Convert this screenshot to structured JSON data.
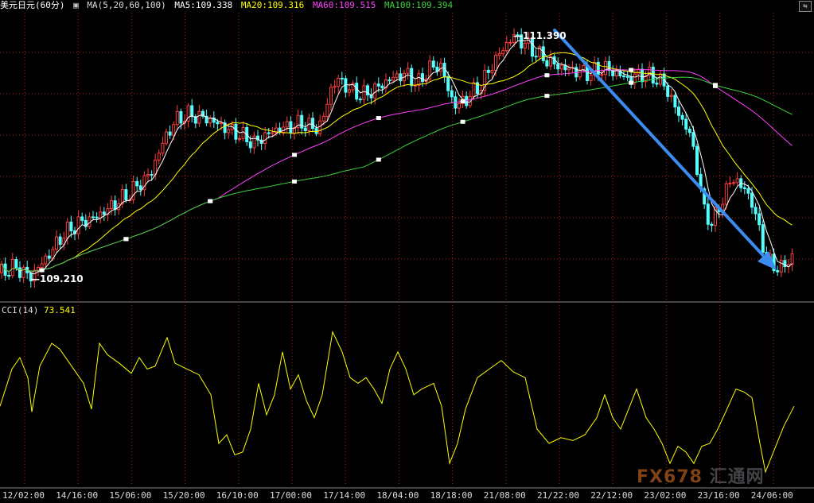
{
  "header": {
    "symbol": "美元日元(60分)",
    "ma_params": "MA(5,20,60,100)",
    "ma5": "MA5:109.338",
    "ma20": "MA20:109.316",
    "ma60": "MA60:109.515",
    "ma100": "MA100:109.394"
  },
  "cci_header": {
    "label": "CCI(14)",
    "value": "73.541"
  },
  "annotations": {
    "high": "111.390",
    "low": "109.210"
  },
  "watermark": {
    "fx": "FX678",
    "cn": "汇通网"
  },
  "colors": {
    "up": "#ff3c3c",
    "down": "#54ffff",
    "ma5": "#ffffff",
    "ma20": "#ffff00",
    "ma60": "#ff40ff",
    "ma100": "#3cd23c",
    "cci": "#ffff00",
    "arrow": "#3c8cf0",
    "grid": "#b41e1e"
  },
  "chart_data": [
    {
      "type": "candlestick",
      "title": "美元日元(60分)",
      "x_ticks": [
        "12/02:00",
        "14/16:00",
        "15/06:00",
        "15/20:00",
        "16/10:00",
        "17/00:00",
        "17/14:00",
        "18/04:00",
        "18/18:00",
        "21/08:00",
        "21/22:00",
        "22/12:00",
        "23/02:00",
        "23/16:00",
        "24/06:00"
      ],
      "ylim": [
        109.0,
        111.6
      ],
      "grid": true,
      "close_path": [
        [
          0,
          109.25
        ],
        [
          20,
          109.3
        ],
        [
          38,
          109.21
        ],
        [
          60,
          109.4
        ],
        [
          80,
          109.6
        ],
        [
          100,
          109.7
        ],
        [
          120,
          109.75
        ],
        [
          140,
          109.85
        ],
        [
          160,
          109.95
        ],
        [
          175,
          110.05
        ],
        [
          190,
          110.15
        ],
        [
          200,
          110.35
        ],
        [
          210,
          110.5
        ],
        [
          220,
          110.62
        ],
        [
          235,
          110.68
        ],
        [
          250,
          110.66
        ],
        [
          265,
          110.63
        ],
        [
          285,
          110.55
        ],
        [
          300,
          110.5
        ],
        [
          320,
          110.42
        ],
        [
          335,
          110.5
        ],
        [
          350,
          110.55
        ],
        [
          365,
          110.57
        ],
        [
          380,
          110.6
        ],
        [
          395,
          110.55
        ],
        [
          405,
          110.6
        ],
        [
          415,
          110.9
        ],
        [
          425,
          111.0
        ],
        [
          440,
          110.9
        ],
        [
          455,
          110.85
        ],
        [
          470,
          110.9
        ],
        [
          490,
          111.0
        ],
        [
          510,
          111.05
        ],
        [
          525,
          110.95
        ],
        [
          540,
          111.1
        ],
        [
          555,
          111.12
        ],
        [
          565,
          110.85
        ],
        [
          575,
          110.75
        ],
        [
          590,
          110.85
        ],
        [
          605,
          110.95
        ],
        [
          620,
          111.15
        ],
        [
          635,
          111.3
        ],
        [
          645,
          111.39
        ],
        [
          660,
          111.32
        ],
        [
          680,
          111.2
        ],
        [
          700,
          111.12
        ],
        [
          720,
          111.08
        ],
        [
          740,
          111.05
        ],
        [
          760,
          111.1
        ],
        [
          775,
          111.05
        ],
        [
          790,
          111.0
        ],
        [
          805,
          111.05
        ],
        [
          820,
          111.02
        ],
        [
          835,
          110.95
        ],
        [
          845,
          110.8
        ],
        [
          855,
          110.65
        ],
        [
          865,
          110.55
        ],
        [
          875,
          110.25
        ],
        [
          885,
          109.8
        ],
        [
          895,
          109.7
        ],
        [
          905,
          109.85
        ],
        [
          915,
          110.05
        ],
        [
          925,
          110.1
        ],
        [
          935,
          110.0
        ],
        [
          945,
          109.9
        ],
        [
          955,
          109.6
        ],
        [
          965,
          109.35
        ],
        [
          975,
          109.3
        ],
        [
          985,
          109.3
        ],
        [
          998,
          109.42
        ]
      ],
      "ma_lines": [
        {
          "name": "MA5",
          "value": "109.338"
        },
        {
          "name": "MA20",
          "value": "109.316"
        },
        {
          "name": "MA60",
          "value": "109.515"
        },
        {
          "name": "MA100",
          "value": "109.394"
        }
      ],
      "annotations": [
        {
          "text": "111.390",
          "x": 645,
          "y": 111.39
        },
        {
          "text": "109.210",
          "x": 38,
          "y": 109.21
        }
      ]
    },
    {
      "type": "line",
      "title": "CCI(14)",
      "value": "73.541",
      "ylim": [
        -300,
        300
      ],
      "series": [
        {
          "points": [
            [
              0,
              -20
            ],
            [
              15,
              110
            ],
            [
              25,
              150
            ],
            [
              35,
              80
            ],
            [
              40,
              -40
            ],
            [
              50,
              120
            ],
            [
              65,
              200
            ],
            [
              75,
              180
            ],
            [
              90,
              120
            ],
            [
              105,
              60
            ],
            [
              115,
              -30
            ],
            [
              125,
              200
            ],
            [
              135,
              160
            ],
            [
              150,
              130
            ],
            [
              165,
              95
            ],
            [
              175,
              150
            ],
            [
              185,
              110
            ],
            [
              195,
              120
            ],
            [
              210,
              220
            ],
            [
              220,
              130
            ],
            [
              235,
              110
            ],
            [
              250,
              90
            ],
            [
              265,
              20
            ],
            [
              275,
              -150
            ],
            [
              285,
              -120
            ],
            [
              295,
              -190
            ],
            [
              305,
              -180
            ],
            [
              315,
              -100
            ],
            [
              325,
              60
            ],
            [
              335,
              -50
            ],
            [
              345,
              20
            ],
            [
              355,
              170
            ],
            [
              365,
              40
            ],
            [
              375,
              90
            ],
            [
              385,
              0
            ],
            [
              395,
              -60
            ],
            [
              405,
              20
            ],
            [
              418,
              240
            ],
            [
              430,
              170
            ],
            [
              440,
              80
            ],
            [
              450,
              60
            ],
            [
              460,
              80
            ],
            [
              470,
              40
            ],
            [
              480,
              -10
            ],
            [
              490,
              110
            ],
            [
              500,
              170
            ],
            [
              510,
              110
            ],
            [
              520,
              20
            ],
            [
              530,
              40
            ],
            [
              545,
              60
            ],
            [
              555,
              -20
            ],
            [
              565,
              -220
            ],
            [
              575,
              -150
            ],
            [
              585,
              -30
            ],
            [
              600,
              80
            ],
            [
              615,
              110
            ],
            [
              630,
              140
            ],
            [
              645,
              100
            ],
            [
              660,
              80
            ],
            [
              675,
              -100
            ],
            [
              690,
              -150
            ],
            [
              705,
              -130
            ],
            [
              720,
              -140
            ],
            [
              735,
              -120
            ],
            [
              750,
              -60
            ],
            [
              760,
              20
            ],
            [
              770,
              -60
            ],
            [
              780,
              -100
            ],
            [
              790,
              -30
            ],
            [
              800,
              40
            ],
            [
              812,
              -60
            ],
            [
              822,
              -100
            ],
            [
              832,
              -150
            ],
            [
              842,
              -220
            ],
            [
              852,
              -160
            ],
            [
              862,
              -180
            ],
            [
              872,
              -220
            ],
            [
              882,
              -160
            ],
            [
              892,
              -150
            ],
            [
              902,
              -100
            ],
            [
              912,
              -40
            ],
            [
              925,
              40
            ],
            [
              935,
              30
            ],
            [
              945,
              10
            ],
            [
              955,
              -150
            ],
            [
              962,
              -250
            ],
            [
              972,
              -180
            ],
            [
              985,
              -90
            ],
            [
              998,
              -20
            ]
          ]
        }
      ]
    }
  ]
}
